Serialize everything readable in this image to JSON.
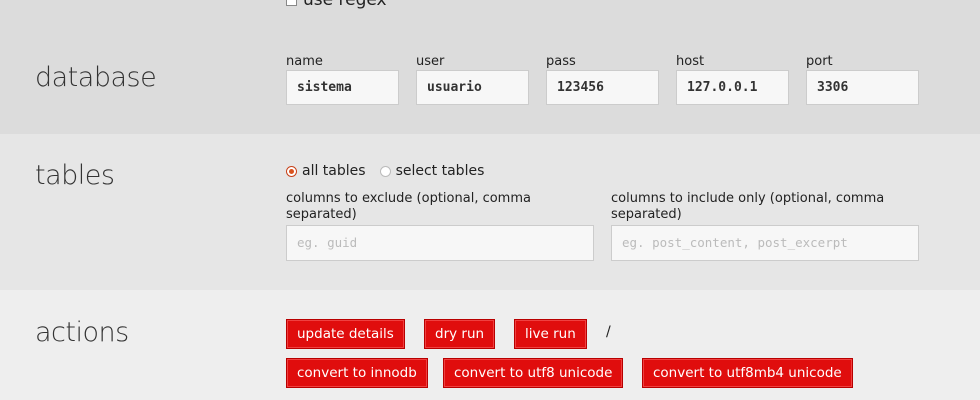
{
  "top": {
    "use_regex_label": "use regex"
  },
  "database": {
    "title": "database",
    "fields": [
      {
        "label": "name",
        "value": "sistema"
      },
      {
        "label": "user",
        "value": "usuario"
      },
      {
        "label": "pass",
        "value": "123456"
      },
      {
        "label": "host",
        "value": "127.0.0.1"
      },
      {
        "label": "port",
        "value": "3306"
      }
    ]
  },
  "tables": {
    "title": "tables",
    "all_tables_label": "all tables",
    "select_tables_label": "select tables",
    "exclude_label": "columns to exclude (optional, comma separated)",
    "exclude_placeholder": "eg. guid",
    "include_label": "columns to include only (optional, comma separated)",
    "include_placeholder": "eg. post_content, post_excerpt"
  },
  "actions": {
    "title": "actions",
    "update_details": "update details",
    "dry_run": "dry run",
    "live_run": "live run",
    "separator": "/",
    "convert_innodb": "convert to innodb",
    "convert_utf8": "convert to utf8 unicode",
    "convert_utf8mb4": "convert to utf8mb4 unicode",
    "button_color": "#e00d0d"
  }
}
